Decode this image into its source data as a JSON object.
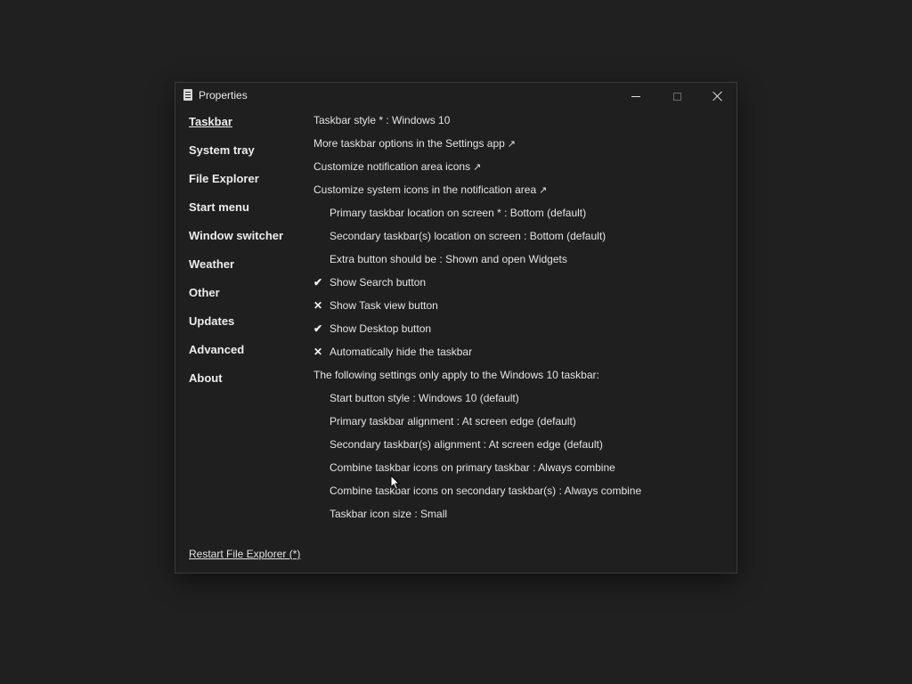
{
  "window": {
    "title": "Properties"
  },
  "sidebar": {
    "items": [
      {
        "label": "Taskbar",
        "active": true
      },
      {
        "label": "System tray"
      },
      {
        "label": "File Explorer"
      },
      {
        "label": "Start menu"
      },
      {
        "label": "Window switcher"
      },
      {
        "label": "Weather"
      },
      {
        "label": "Other"
      },
      {
        "label": "Updates"
      },
      {
        "label": "Advanced"
      },
      {
        "label": "About"
      }
    ]
  },
  "settings": {
    "rows": [
      {
        "text": "Taskbar style * : Windows 10"
      },
      {
        "text": "More taskbar options in the Settings app",
        "external": "↗"
      },
      {
        "text": "Customize notification area icons",
        "external": "↗"
      },
      {
        "text": "Customize system icons in the notification area",
        "external": "↗"
      },
      {
        "text": "Primary taskbar location on screen * : Bottom (default)"
      },
      {
        "text": "Secondary taskbar(s) location on screen : Bottom (default)"
      },
      {
        "text": "Extra button should be : Shown and open Widgets"
      },
      {
        "text": "Show Search button",
        "mark": "✔"
      },
      {
        "text": "Show Task view button",
        "mark": "✕"
      },
      {
        "text": "Show Desktop button",
        "mark": "✔"
      },
      {
        "text": "Automatically hide the taskbar",
        "mark": "✕"
      },
      {
        "text": "The following settings only apply to the Windows 10 taskbar:"
      },
      {
        "text": "Start button style : Windows 10 (default)"
      },
      {
        "text": "Primary taskbar alignment : At screen edge (default)"
      },
      {
        "text": "Secondary taskbar(s) alignment : At screen edge (default)"
      },
      {
        "text": "Combine taskbar icons on primary taskbar : Always combine"
      },
      {
        "text": "Combine taskbar icons on secondary taskbar(s) : Always combine"
      },
      {
        "text": "Taskbar icon size : Small"
      }
    ]
  },
  "footer": {
    "restart_label": "Restart File Explorer (*)"
  },
  "colors": {
    "background": "#202020",
    "window": "#1f1f1f",
    "text": "#e4e4e4"
  },
  "icons": {
    "app": "properties-app-icon",
    "minimize": "minimize-icon",
    "maximize": "maximize-icon",
    "close": "close-icon",
    "check": "checkmark-icon",
    "cross": "cross-icon",
    "external": "external-link-icon"
  }
}
